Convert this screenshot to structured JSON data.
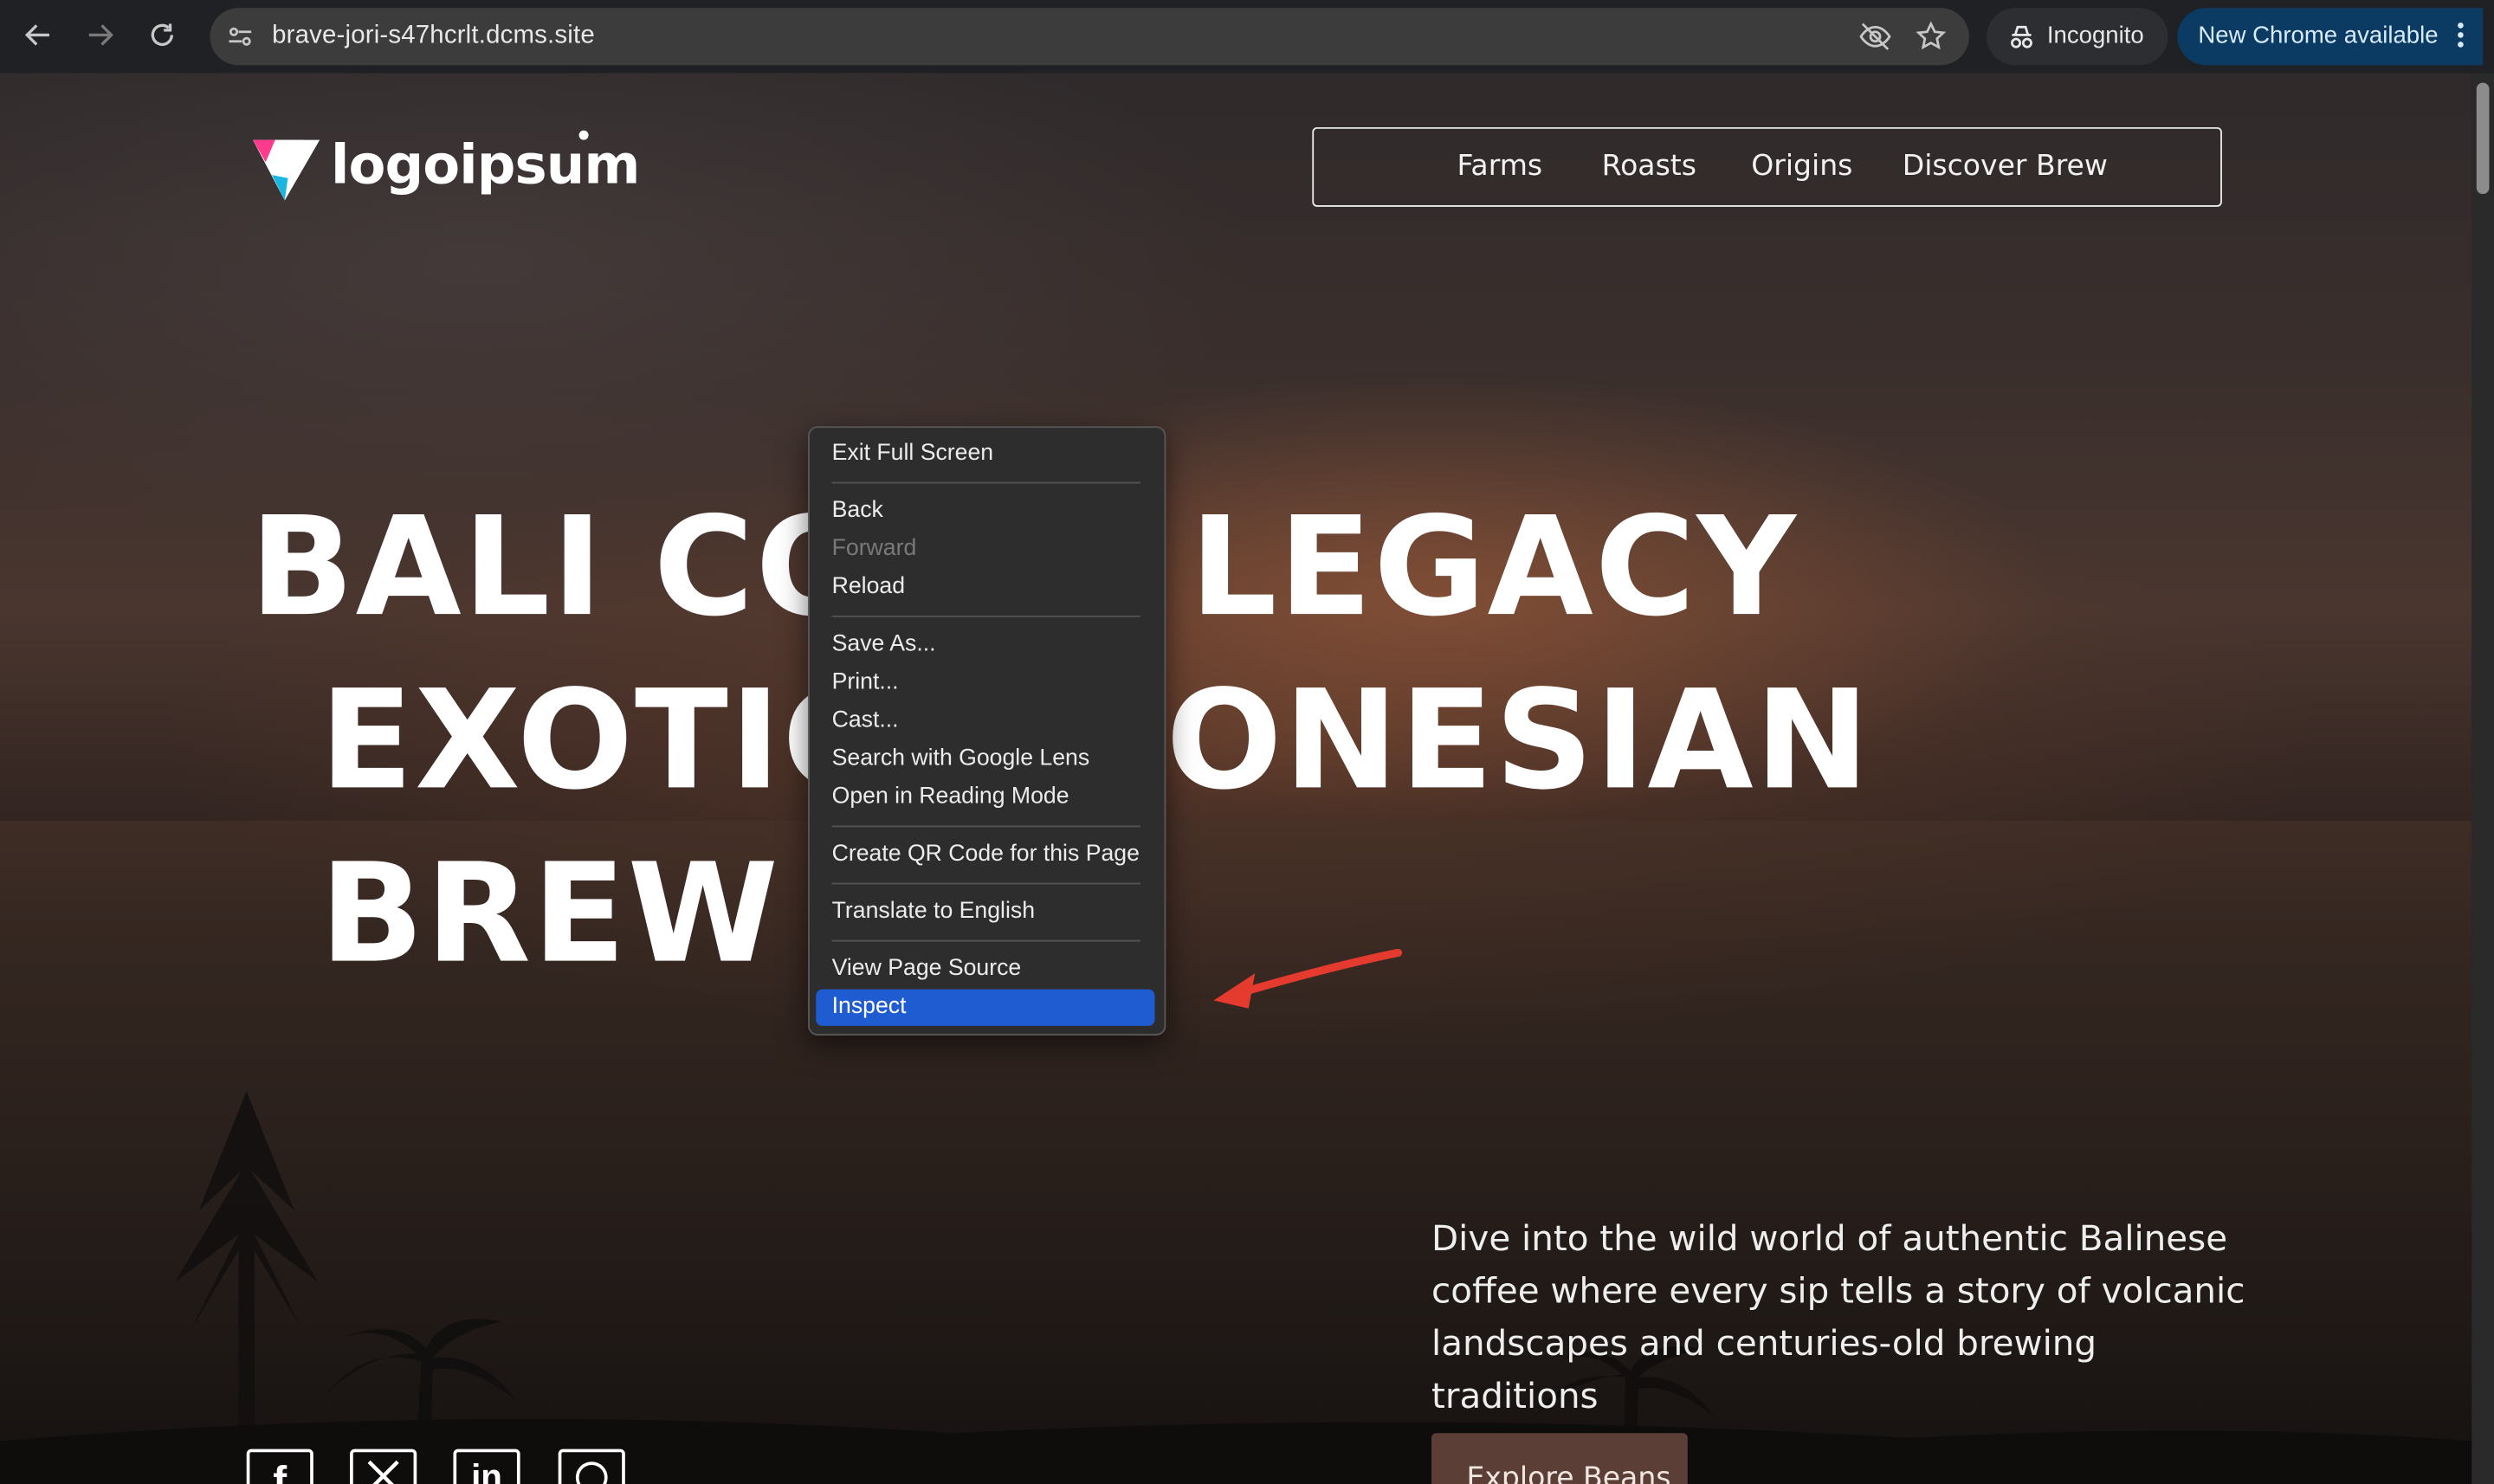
{
  "browser": {
    "url": "brave-jori-s47hcrlt.dcms.site",
    "incognito_label": "Incognito",
    "update_label": "New Chrome available"
  },
  "site": {
    "logo_text": "logoipsum",
    "nav": [
      "Farms",
      "Roasts",
      "Origins",
      "Discover Brew"
    ],
    "hero_lines": [
      "BALI CO",
      "LEGACY",
      "EXOTIC",
      "ONESIAN",
      "BREW"
    ],
    "description": "Dive into the wild world of authentic Balinese coffee where every sip tells a story of volcanic landscapes and centuries-old brewing traditions",
    "cta_label": "Explore Beans",
    "social_icons": [
      "facebook-icon",
      "x-icon",
      "linkedin-icon",
      "whatsapp-icon"
    ]
  },
  "context_menu": {
    "items": [
      "Exit Full Screen",
      "Back",
      "Forward",
      "Reload",
      "Save As...",
      "Print...",
      "Cast...",
      "Search with Google Lens",
      "Open in Reading Mode",
      "Create QR Code for this Page",
      "Translate to English",
      "View Page Source",
      "Inspect"
    ],
    "disabled_item": "Forward",
    "highlighted_item": "Inspect"
  },
  "annotation": {
    "arrow_color": "#e53b2f"
  }
}
